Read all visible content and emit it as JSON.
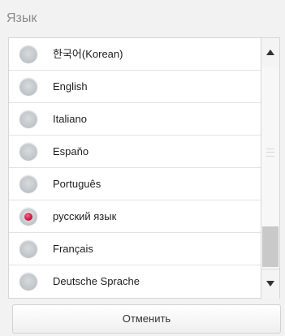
{
  "dialog": {
    "title": "Язык",
    "cancel_label": "Отменить"
  },
  "languages": [
    {
      "label": "한국어(Korean)",
      "selected": false
    },
    {
      "label": "English",
      "selected": false
    },
    {
      "label": "Italiano",
      "selected": false
    },
    {
      "label": "Espaňo",
      "selected": false
    },
    {
      "label": "Português",
      "selected": false
    },
    {
      "label": "русский язык",
      "selected": true
    },
    {
      "label": "Français",
      "selected": false
    },
    {
      "label": "Deutsche Sprache",
      "selected": false
    }
  ],
  "colors": {
    "selected_radio": "#c8103b",
    "background": "#f2f2f2"
  },
  "icons": {
    "scroll_up": "triangle-up-icon",
    "scroll_down": "triangle-down-icon"
  }
}
